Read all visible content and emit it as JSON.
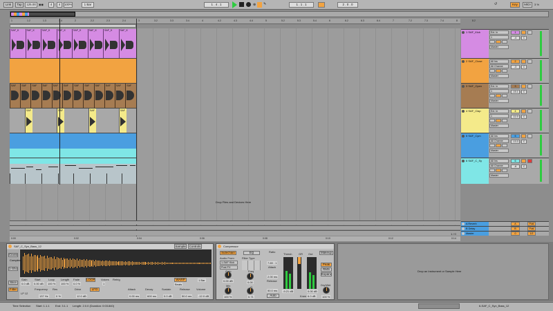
{
  "transport": {
    "link": "Link",
    "tap": "Tap",
    "tempo": "125.00",
    "sig_num": "4",
    "sig_den": "4",
    "zoom": "100%",
    "quant": "1 Bar",
    "position": "1 . 4 . 1",
    "loop_start": "1 . 1 . 1",
    "loop_len": "2 . 0 . 0",
    "key": "Key",
    "midi": "MIDI",
    "cpu": "3 %"
  },
  "colors": {
    "kick": "#d58be3",
    "closedhat": "#f2a341",
    "openhat": "#a67c52",
    "clap": "#f4ea8a",
    "cymbal": "#4a9ee0",
    "cymbal_top": "#7fe6e6",
    "synth": "#b8c5ca",
    "synth_hdr": "#7fe6e6",
    "accent": "#f2a341"
  },
  "ruler": [
    "1",
    "1.2",
    "1.3",
    "1.4",
    "2",
    "2.2",
    "2.3",
    "2.4",
    "3",
    "3.2",
    "3.3",
    "3.4",
    "4",
    "4.2",
    "4.3",
    "4.4",
    "5",
    "5.2",
    "5.3",
    "5.4",
    "6",
    "6.2",
    "6.3",
    "6.4",
    "7",
    "7.2",
    "7.3",
    "7.4",
    "8",
    "8.2"
  ],
  "time_ruler": [
    "0:00",
    "0:02",
    "0:04",
    "0:06",
    "0:08",
    "0:10",
    "0:12",
    "0:14"
  ],
  "clip_labels": {
    "kick": [
      "SAF_K",
      "SAF_K",
      "SAF_K",
      "SAF_K",
      "SAF_K",
      "SAF_K",
      "SAF_K",
      "SAF_K"
    ],
    "openhat": [
      "SAF",
      "SAF",
      "SAF",
      "SAF",
      "SAF",
      "SAF",
      "SAF",
      "SAF",
      "SAF",
      "SAF",
      "SAF",
      "SAF"
    ],
    "clap": [
      "SAF",
      "SAF",
      "SAF",
      "SAF"
    ]
  },
  "tracks": [
    {
      "name": "1 SAF_Kick",
      "input": "Ext. In",
      "channel": "1",
      "vol": "-4",
      "pan": "C",
      "sends": "S",
      "out": "Master"
    },
    {
      "name": "2 SAF_Close",
      "input": "All Ins",
      "channel": "All Channe",
      "vol": "-3",
      "pan": "C",
      "sends": "S",
      "out": "Master"
    },
    {
      "name": "3 SAF_Open",
      "input": "Ext. In",
      "channel": "1",
      "vol": "-15.1",
      "pan": "C",
      "sends": "S",
      "out": "Master"
    },
    {
      "name": "4 SAF_Clap",
      "input": "Ext. In",
      "channel": "1",
      "vol": "-11.9",
      "pan": "C",
      "sends": "S",
      "out": "Master"
    },
    {
      "name": "5 SAF_Cym",
      "input": "All Ins",
      "channel": "All Channe",
      "vol": "-13.3",
      "pan": "C",
      "sends": "S",
      "out": "Master"
    },
    {
      "name": "6 SAF_C_Sy",
      "input": "All Ins",
      "channel": "All Channe",
      "vol": "-6",
      "pan": "C",
      "sends": "S",
      "out": "Master"
    }
  ],
  "returns": [
    {
      "name": "A Reverb",
      "num": "A",
      "out": "Post"
    },
    {
      "name": "B Delay",
      "num": "B",
      "out": "Post"
    },
    {
      "name": "Master",
      "num": "0",
      "out": "1/2"
    }
  ],
  "drop_text": "Drop Files and Devices Here",
  "sample": {
    "title": "SAF_C_Syn_Bass_12",
    "tab_sample": "Sample",
    "tab_controls": "Controls",
    "warp_mode": "Complex",
    "gain_lbl": "Gain",
    "gain": "0.0 dB",
    "start_lbl": "Start",
    "start": "0.00 dB",
    "loop_lbl": "Loop",
    "loop": "100 %",
    "length_lbl": "Length",
    "length": "100 %",
    "fade_lbl": "Fade",
    "fade": "0.0 %",
    "voices_lbl": "Voices",
    "voices": "1",
    "retrig_lbl": "Retrig",
    "warp": "WARP",
    "beats": "Beats",
    "bar": "1 Bar",
    "filter_lbl": "Filter",
    "freq_lbl": "Frequency",
    "res_lbl": "Res",
    "freq": "137 Hz",
    "res": "0 %",
    "drive_lbl": "Drive",
    "drive": "12.0 dB",
    "lfo_lbl": "LFO",
    "attack_lbl": "Attack",
    "attack": "0.00 ms",
    "decay_lbl": "Decay",
    "decay": "600 ms",
    "sustain_lbl": "Sustain",
    "sustain": "0.0 dB",
    "release_lbl": "Release",
    "release": "50.0 ms",
    "volume_lbl": "Volume",
    "volume": "-12.0 dB",
    "classic": "Classic",
    "one_shot": "1-Shot",
    "slice": "Slice",
    "loop_btn": "LOOP",
    "lp": "LP 12"
  },
  "compressor": {
    "title": "Compressor",
    "sidechain": "Sidechain",
    "eq": "EQ",
    "audio_from": "Audio From",
    "source": "1-SAF Kick",
    "pre": "Post FX",
    "filter_type": "Filter Type",
    "mix_lbl": "Mix",
    "mix": "100 %",
    "gain_lbl": "Gain",
    "gain": "0.00 dB",
    "freq_lbl": "Freq",
    "freq": "0.00",
    "q_lbl": "Q",
    "q": "0.71",
    "ratio_lbl": "Ratio",
    "ratio": "7.69 : 1",
    "attack_lbl": "Attack",
    "attack": "2.00 ms",
    "release_lbl": "Release",
    "release": "50.0 ms",
    "auto": "Auto",
    "thresh_lbl": "Thresh",
    "gr_lbl": "GR",
    "out_lbl": "Out",
    "thresh": "-9.21 dB",
    "out": "0.00 dB",
    "knee_lbl": "Knee",
    "knee": "6.0 dB",
    "makeup": "Makeup",
    "peak": "Peak",
    "rms": "RMS",
    "expand": "Expand",
    "drywet_lbl": "Dry/Wet",
    "drywet": "100 %"
  },
  "drop_instrument": "Drop an Instrument or Sample Here",
  "status": {
    "left": "Time Selection",
    "start": "Start: 1.1.1",
    "end": "End: 3.1.1",
    "length": "Length: 2.0.0 (Duration: 0:03.840)",
    "track": "6-SAF_C_Syn_Bass_12"
  },
  "io_page": "1 / 0"
}
